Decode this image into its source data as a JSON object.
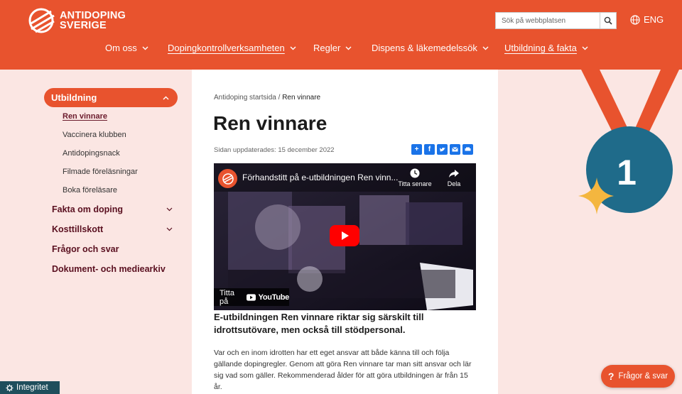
{
  "brand": {
    "line1": "ANTIDOPING",
    "line2": "SVERIGE"
  },
  "search": {
    "placeholder": "Sök på webbplatsen"
  },
  "lang": "ENG",
  "nav": [
    {
      "label": "Om oss"
    },
    {
      "label": "Dopingkontrollverksamheten"
    },
    {
      "label": "Regler"
    },
    {
      "label": "Dispens & läkemedelssök"
    },
    {
      "label": "Utbildning & fakta"
    }
  ],
  "sidebar": {
    "active": "Utbildning",
    "sub": [
      "Ren vinnare",
      "Vaccinera klubben",
      "Antidopingsnack",
      "Filmade föreläsningar",
      "Boka föreläsare"
    ],
    "items": [
      "Fakta om doping",
      "Kosttillskott",
      "Frågor och svar",
      "Dokument- och mediearkiv"
    ]
  },
  "breadcrumb": {
    "home": "Antidoping startsida",
    "sep": "/",
    "current": "Ren vinnare"
  },
  "page": {
    "title": "Ren vinnare",
    "updated": "Sidan uppdaterades: 15 december 2022",
    "lead": "E-utbildningen Ren vinnare riktar sig särskilt till idrottsutövare, men också till stödpersonal.",
    "body": "Var och en inom idrotten har ett eget ansvar att både känna till och följa gällande dopingregler. Genom att göra Ren vinnare tar man sitt ansvar och lär sig vad som gäller. Rekommenderad ålder för att göra utbildningen är från 15 år."
  },
  "video": {
    "title": "Förhandstitt på e-utbildningen Ren vinn...",
    "watch_later": "Titta senare",
    "share": "Dela",
    "watch_on": "Titta på",
    "youtube": "YouTube"
  },
  "medal": {
    "number": "1"
  },
  "faq_button": "Frågor & svar",
  "integrity": "Integritet",
  "colors": {
    "brand": "#e8532e",
    "dark": "#5a1020",
    "teal": "#1f6b8a",
    "page_bg": "#fbe6e3"
  }
}
